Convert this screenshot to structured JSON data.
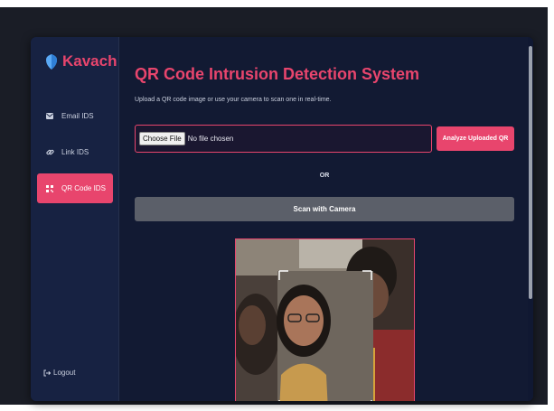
{
  "brand": {
    "name": "Kavach"
  },
  "sidebar": {
    "items": [
      {
        "label": "Email IDS",
        "icon": "envelope-icon",
        "active": false
      },
      {
        "label": "Link IDS",
        "icon": "link-icon",
        "active": false
      },
      {
        "label": "QR Code IDS",
        "icon": "qrcode-icon",
        "active": true
      }
    ],
    "logout_label": "Logout"
  },
  "main": {
    "title": "QR Code Intrusion Detection System",
    "subtitle": "Upload a QR code image or use your camera to scan one in real-time.",
    "file_input": {
      "button_label": "Choose File",
      "status": "No file chosen"
    },
    "analyze_label": "Analyze Uploaded QR",
    "or_label": "OR",
    "scan_label": "Scan with Camera"
  },
  "colors": {
    "accent": "#e8456d",
    "background": "#121a33",
    "sidebar": "#172242",
    "scan_button": "#5b5f69"
  }
}
